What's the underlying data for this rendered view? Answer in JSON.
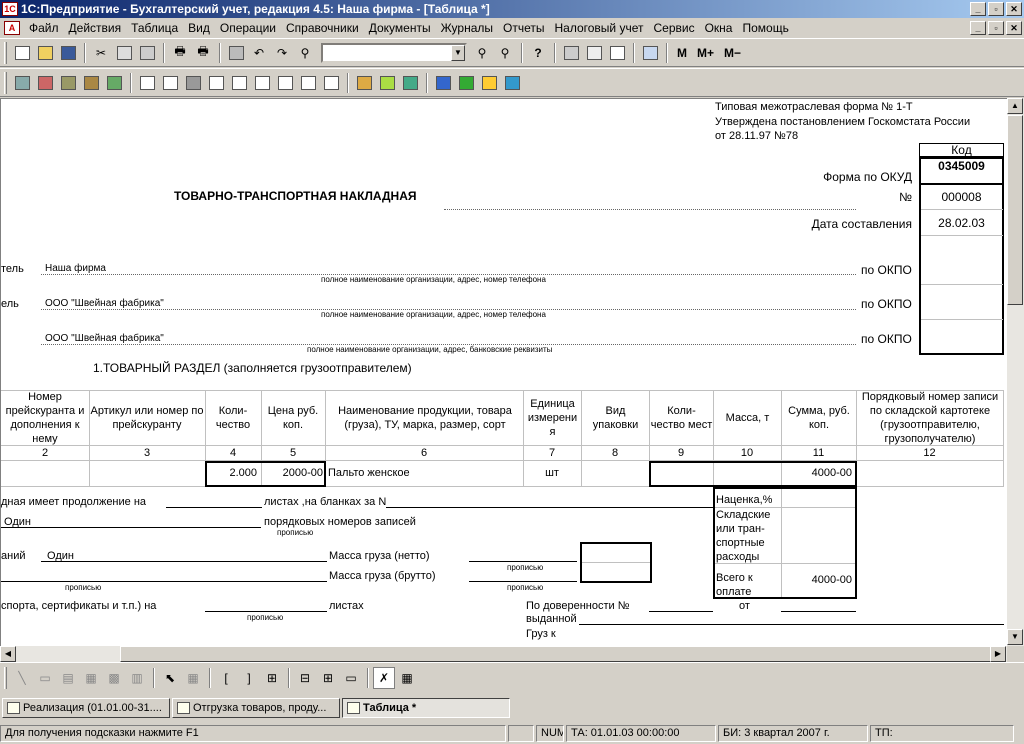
{
  "window": {
    "title": "1С:Предприятие - Бухгалтерский учет, редакция 4.5: Наша фирма - [Таблица  *]",
    "app_icon": "1c-icon"
  },
  "menu": [
    "Файл",
    "Действия",
    "Таблица",
    "Вид",
    "Операции",
    "Справочники",
    "Документы",
    "Журналы",
    "Отчеты",
    "Налоговый учет",
    "Сервис",
    "Окна",
    "Помощь"
  ],
  "toolbar2_labels": {
    "m": "М",
    "mplus": "М+",
    "mminus": "М−"
  },
  "document": {
    "form_note": [
      "Типовая межотраслевая форма № 1-Т",
      "Утверждена постановлением Госкомстата России",
      "от 28.11.97 №78"
    ],
    "kod_header": "Код",
    "okud_label": "Форма по ОКУД",
    "okud_value": "0345009",
    "number_label": "№",
    "number_value": "000008",
    "date_label": "Дата составления",
    "date_value": "28.02.03",
    "title": "ТОВАРНО-ТРАНСПОРТНАЯ НАКЛАДНАЯ",
    "parties": [
      {
        "prefix": "тель",
        "name": "Наша фирма",
        "hint": "полное наименование организации, адрес, номер телефона",
        "okpo": "по ОКПО"
      },
      {
        "prefix": "ель",
        "name": "ООО \"Швейная фабрика\"",
        "hint": "полное наименование организации, адрес, номер телефона",
        "okpo": "по ОКПО"
      },
      {
        "prefix": "",
        "name": "ООО \"Швейная фабрика\"",
        "hint": "полное наименование организации, адрес, банковские реквизиты",
        "okpo": "по ОКПО"
      }
    ],
    "section_title": "1.ТОВАРНЫЙ РАЗДЕЛ (заполняется грузоотправителем)",
    "columns": [
      {
        "head": "Номер прейскуранта и дополнения к нему",
        "num": "2"
      },
      {
        "head": "Артикул или номер по прейскуранту",
        "num": "3"
      },
      {
        "head": "Коли- чество",
        "num": "4"
      },
      {
        "head": "Цена руб. коп.",
        "num": "5"
      },
      {
        "head": "Наименование продукции, товара (груза), ТУ, марка, размер, сорт",
        "num": "6"
      },
      {
        "head": "Единица измерени я",
        "num": "7"
      },
      {
        "head": "Вид упаковки",
        "num": "8"
      },
      {
        "head": "Коли- чество мест",
        "num": "9"
      },
      {
        "head": "Масса,   т",
        "num": "10"
      },
      {
        "head": "Сумма,  руб. коп.",
        "num": "11"
      },
      {
        "head": "Порядковый номер записи по складской картотеке (грузоотправителю, грузополучателю)",
        "num": "12"
      }
    ],
    "row": {
      "qty": "2.000",
      "price": "2000-00",
      "name": "Пальто женское",
      "unit": "шт",
      "sum": "4000-00"
    },
    "footer": {
      "continue_left": "дная имеет продолжение на",
      "continue_mid": "листах ,на бланках за N",
      "records_value": "Один",
      "records_label": "порядковых номеров записей",
      "propisyu": "прописью",
      "names_prefix": "аний",
      "names_value": "Один",
      "mass_net": "Масса груза (нетто)",
      "mass_gross": "Масса груза (брутто)",
      "docs_label": "спорта, сертификаты и т.п.) на",
      "docs_suffix": "листах",
      "proxy_label": "По доверенности №",
      "proxy_from": "от",
      "issued": "выданной",
      "cargo": "Груз к",
      "markup": "Наценка,%",
      "storage": "Складские или тран- спортные расходы",
      "total_label": "Всего к оплате",
      "total_value": "4000-00"
    }
  },
  "taskbar": [
    {
      "label": "Реализация (01.01.00-31....",
      "active": false
    },
    {
      "label": "Отгрузка товаров, проду...",
      "active": false
    },
    {
      "label": "Таблица  *",
      "active": true
    }
  ],
  "status": {
    "hint": "Для получения подсказки нажмите F1",
    "num": "NUM",
    "ta": "ТА: 01.01.03  00:00:00",
    "bi": "БИ: 3 квартал 2007 г.",
    "tp": "ТП:"
  }
}
